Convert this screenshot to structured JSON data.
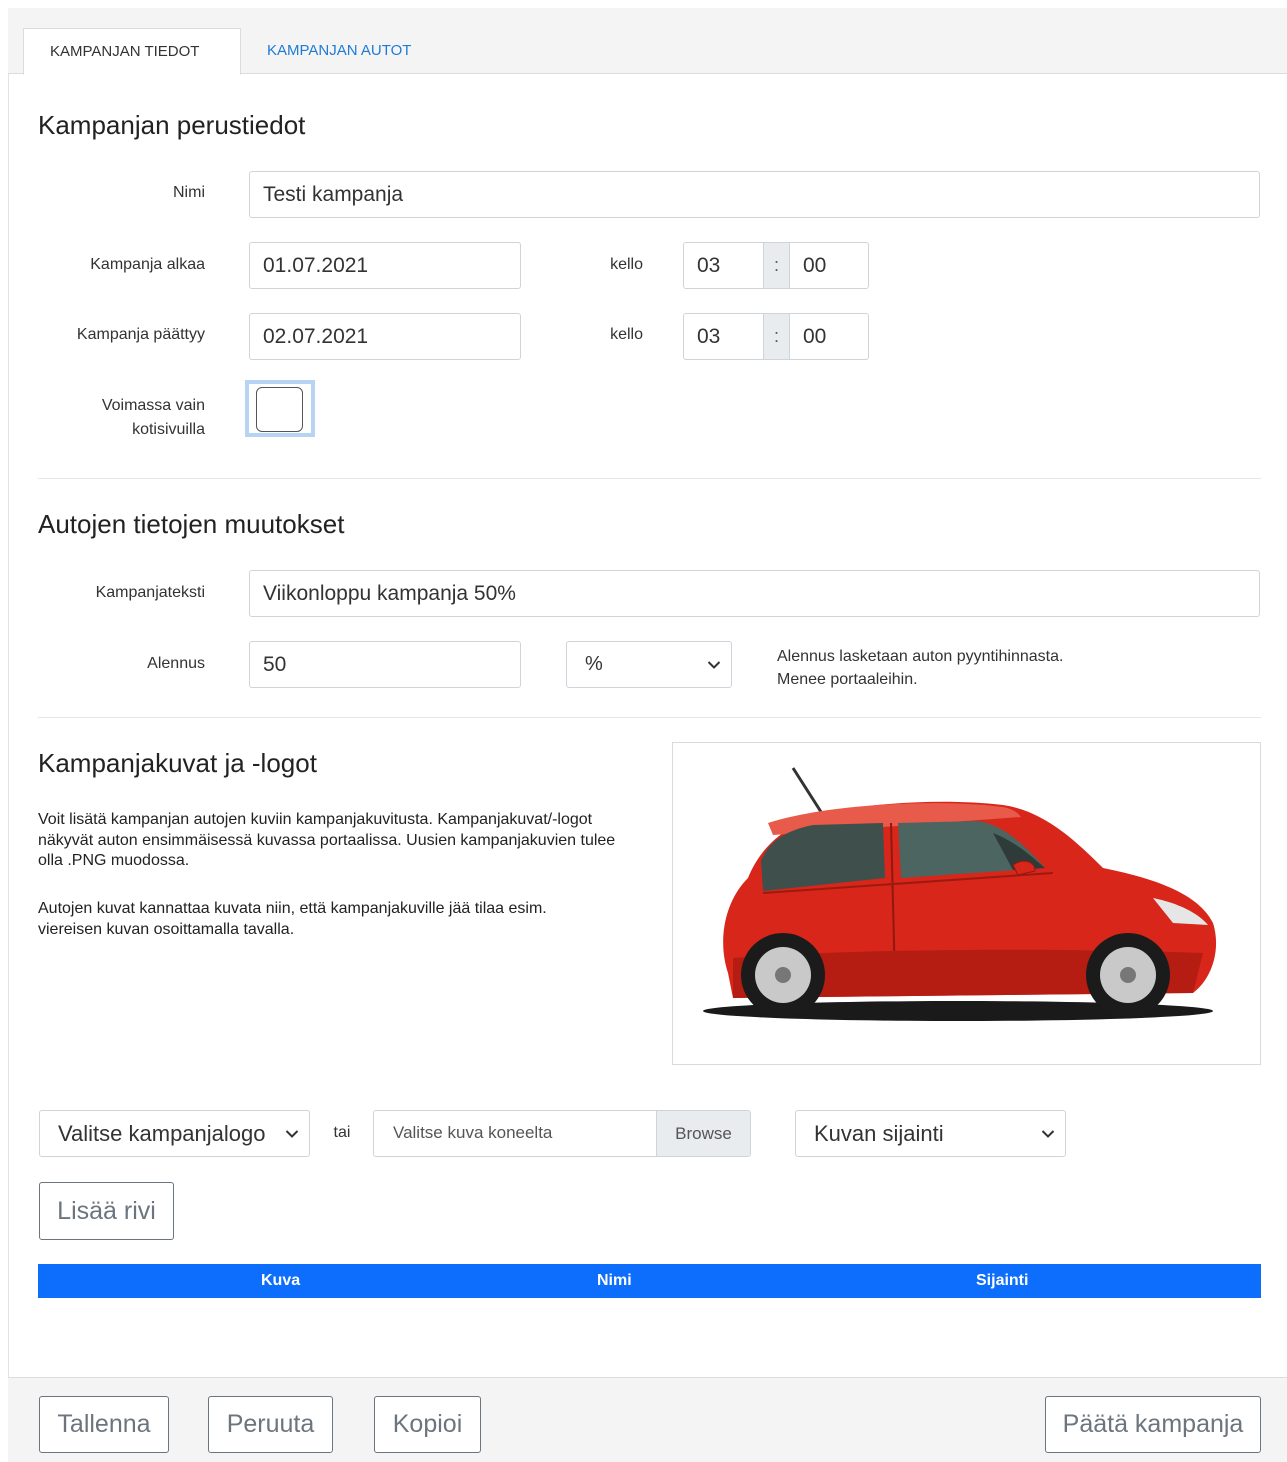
{
  "tabs": [
    {
      "label": "KAMPANJAN TIEDOT",
      "active": true
    },
    {
      "label": "KAMPANJAN AUTOT",
      "active": false
    }
  ],
  "basic": {
    "title": "Kampanjan perustiedot",
    "name_label": "Nimi",
    "name_value": "Testi kampanja",
    "start_label": "Kampanja alkaa",
    "start_date": "01.07.2021",
    "start_time_label": "kello",
    "start_hour": "03",
    "start_minute": "00",
    "end_label": "Kampanja päättyy",
    "end_date": "02.07.2021",
    "end_time_label": "kello",
    "end_hour": "03",
    "end_minute": "00",
    "time_separator": ":",
    "homepage_label_line1": "Voimassa vain",
    "homepage_label_line2": "kotisivuilla",
    "homepage_checked": false
  },
  "changes": {
    "title": "Autojen tietojen muutokset",
    "text_label": "Kampanjateksti",
    "text_value": "Viikonloppu kampanja 50%",
    "discount_label": "Alennus",
    "discount_value": "50",
    "discount_unit": "%",
    "hint_line1": "Alennus lasketaan auton pyyntihinnasta.",
    "hint_line2": "Menee portaaleihin."
  },
  "images": {
    "title": "Kampanjakuvat ja -logot",
    "para1": "Voit lisätä kampanjan autojen kuviin kampanjakuvitusta. Kampanjakuvat/-logot näkyvät auton ensimmäisessä kuvassa portaalissa. Uusien kampanjakuvien tulee olla .PNG muodossa.",
    "para2": "Autojen kuvat kannattaa kuvata niin, että kampanjakuville jää tilaa esim. viereisen kuvan osoittamalla tavalla.",
    "logo_select": "Valitse kampanjalogo",
    "or_text": "tai",
    "file_placeholder": "Valitse kuva koneelta",
    "browse_label": "Browse",
    "position_select": "Kuvan sijainti",
    "add_row_label": "Lisää rivi",
    "table_headers": [
      "Kuva",
      "Nimi",
      "Sijainti"
    ]
  },
  "footer": {
    "save_label": "Tallenna",
    "cancel_label": "Peruuta",
    "copy_label": "Kopioi",
    "end_campaign_label": "Päätä kampanja"
  },
  "colors": {
    "accent": "#0d6efd",
    "link": "#1f7bd6",
    "car_body": "#d8261a"
  }
}
